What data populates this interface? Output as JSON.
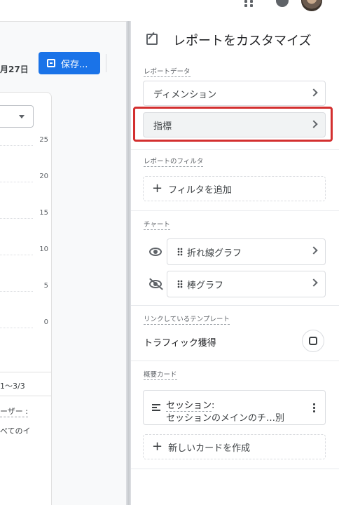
{
  "main": {
    "date_range": "月27日",
    "save_label": "保存...",
    "y_ticks": [
      "25",
      "20",
      "15",
      "10",
      "5",
      "0"
    ],
    "range_text": "1〜3/3",
    "user_text": "ーザー :",
    "all_text": "べてのイ"
  },
  "panel": {
    "title": "レポートをカスタマイズ",
    "report_data_label": "レポートデータ",
    "dimension_label": "ディメンション",
    "metric_label": "指標",
    "filter_section_label": "レポートのフィルタ",
    "add_filter_label": "フィルタを追加",
    "chart_section_label": "チャート",
    "line_chart_label": "折れ線グラフ",
    "bar_chart_label": "棒グラフ",
    "template_section_label": "リンクしているテンプレート",
    "template_name": "トラフィック獲得",
    "summary_section_label": "概要カード",
    "summary_line1": "セッション",
    "summary_colon": ":",
    "summary_line2": "セッションのメインのチ…別",
    "new_card_label": "新しいカードを作成"
  }
}
